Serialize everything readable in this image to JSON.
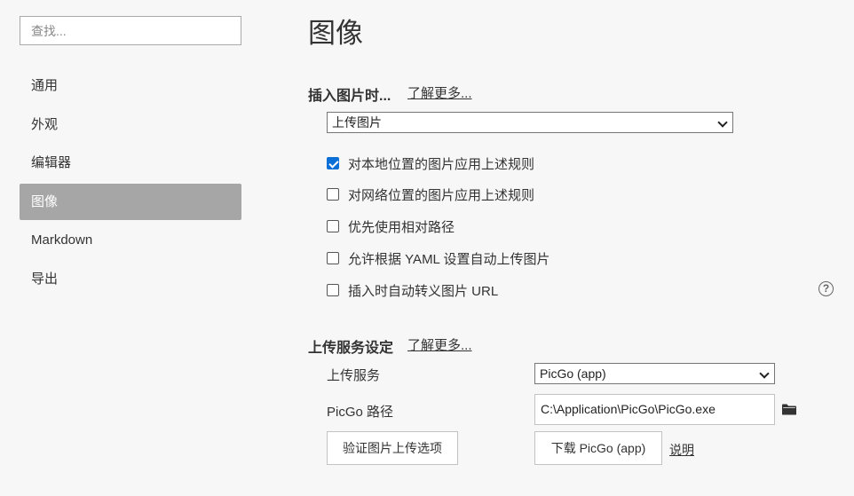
{
  "sidebar": {
    "search_placeholder": "查找...",
    "items": [
      {
        "label": "通用",
        "active": false
      },
      {
        "label": "外观",
        "active": false
      },
      {
        "label": "编辑器",
        "active": false
      },
      {
        "label": "图像",
        "active": true
      },
      {
        "label": "Markdown",
        "active": false
      },
      {
        "label": "导出",
        "active": false
      }
    ]
  },
  "main": {
    "title": "图像",
    "insert_section": {
      "heading": "插入图片时...",
      "learn_more": "了解更多...",
      "action_select": "上传图片",
      "options": [
        {
          "label": "对本地位置的图片应用上述规则",
          "checked": true
        },
        {
          "label": "对网络位置的图片应用上述规则",
          "checked": false
        },
        {
          "label": "优先使用相对路径",
          "checked": false
        },
        {
          "label": "允许根据 YAML 设置自动上传图片",
          "checked": false
        },
        {
          "label": "插入时自动转义图片 URL",
          "checked": false
        }
      ],
      "help_glyph": "?"
    },
    "upload_section": {
      "heading": "上传服务设定",
      "learn_more": "了解更多...",
      "service_label": "上传服务",
      "service_value": "PicGo (app)",
      "path_label": "PicGo 路径",
      "path_value": "C:\\Application\\PicGo\\PicGo.exe",
      "verify_button": "验证图片上传选项",
      "download_button": "下载 PicGo (app)",
      "doc_link": "说明"
    }
  },
  "colors": {
    "background": "#f7f7f7",
    "active_nav": "#a6a6a6",
    "checkbox_checked": "#0a6fd6"
  }
}
